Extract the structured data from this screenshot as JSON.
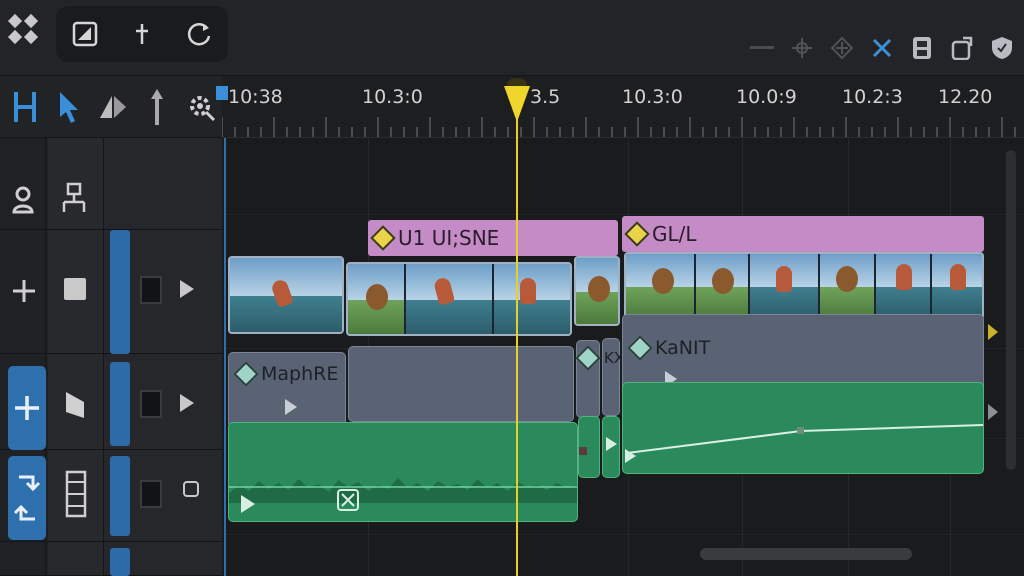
{
  "ruler": {
    "labels": [
      "10:38",
      "10.3:0",
      "3.5",
      "10.3:0",
      "10.0:9",
      "10.2:3",
      "12.20"
    ]
  },
  "clips": {
    "title_a": "U1 UI;SNE",
    "title_b": "GL/L",
    "gray_a": "MaphRE",
    "gray_b": "KX",
    "gray_c": "KaNIT"
  },
  "colors": {
    "accent_blue": "#2e6fae",
    "playhead": "#e8d02a",
    "title_clip": "#c58bc6",
    "audio_clip": "#2b8a5c",
    "gray_clip": "#596373"
  },
  "icons": {
    "toolbar": [
      "grid-icon",
      "image-icon",
      "add-icon",
      "refresh-icon"
    ],
    "tools": [
      "ripple-tool-icon",
      "select-tool-icon",
      "blade-tool-icon",
      "arrow-up-icon",
      "settings-gear-icon"
    ],
    "right": [
      "minus-icon",
      "crosshair-icon",
      "diamond-icon",
      "close-icon",
      "save-icon",
      "export-icon",
      "shield-icon"
    ]
  }
}
